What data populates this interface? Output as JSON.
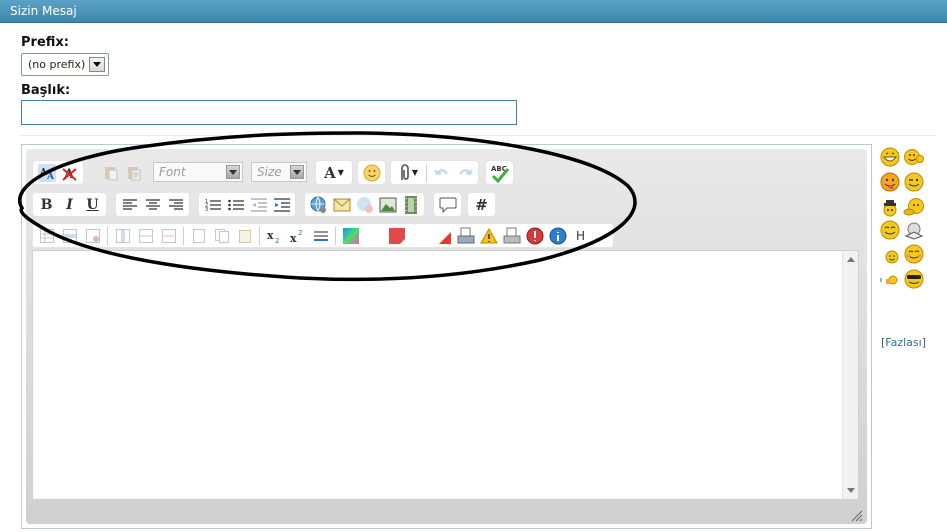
{
  "header": {
    "title": "Sizin Mesaj"
  },
  "form": {
    "prefix_label": "Prefix:",
    "prefix_value": "(no prefix)",
    "title_label": "Başlık:",
    "title_value": ""
  },
  "toolbar": {
    "font_placeholder": "Font",
    "size_placeholder": "Size",
    "font_color_label": "A",
    "bold_label": "B",
    "italic_label": "I",
    "underline_label": "U",
    "hash_label": "#",
    "heading_label": "H",
    "spellcheck_label": "ABC"
  },
  "editor": {
    "content": ""
  },
  "smilies": {
    "icons": [
      "grin-smiley-icon",
      "applause-smiley-icon",
      "tongue-smiley-icon",
      "wink-smiley-icon",
      "hat-smiley-icon",
      "thinking-smiley-icon",
      "smile-smiley-icon",
      "reading-smiley-icon",
      "small-smile-smiley-icon",
      "blush-smiley-icon",
      "thumbs-smiley-icon",
      "cool-smiley-icon"
    ],
    "more_open": "[",
    "more_label": "Fazlası",
    "more_close": "]"
  },
  "colors": {
    "titlebar": "#4a95b9",
    "input_border": "#3f7fa2",
    "link": "#2f6f91",
    "smiley": "#f2b200"
  }
}
